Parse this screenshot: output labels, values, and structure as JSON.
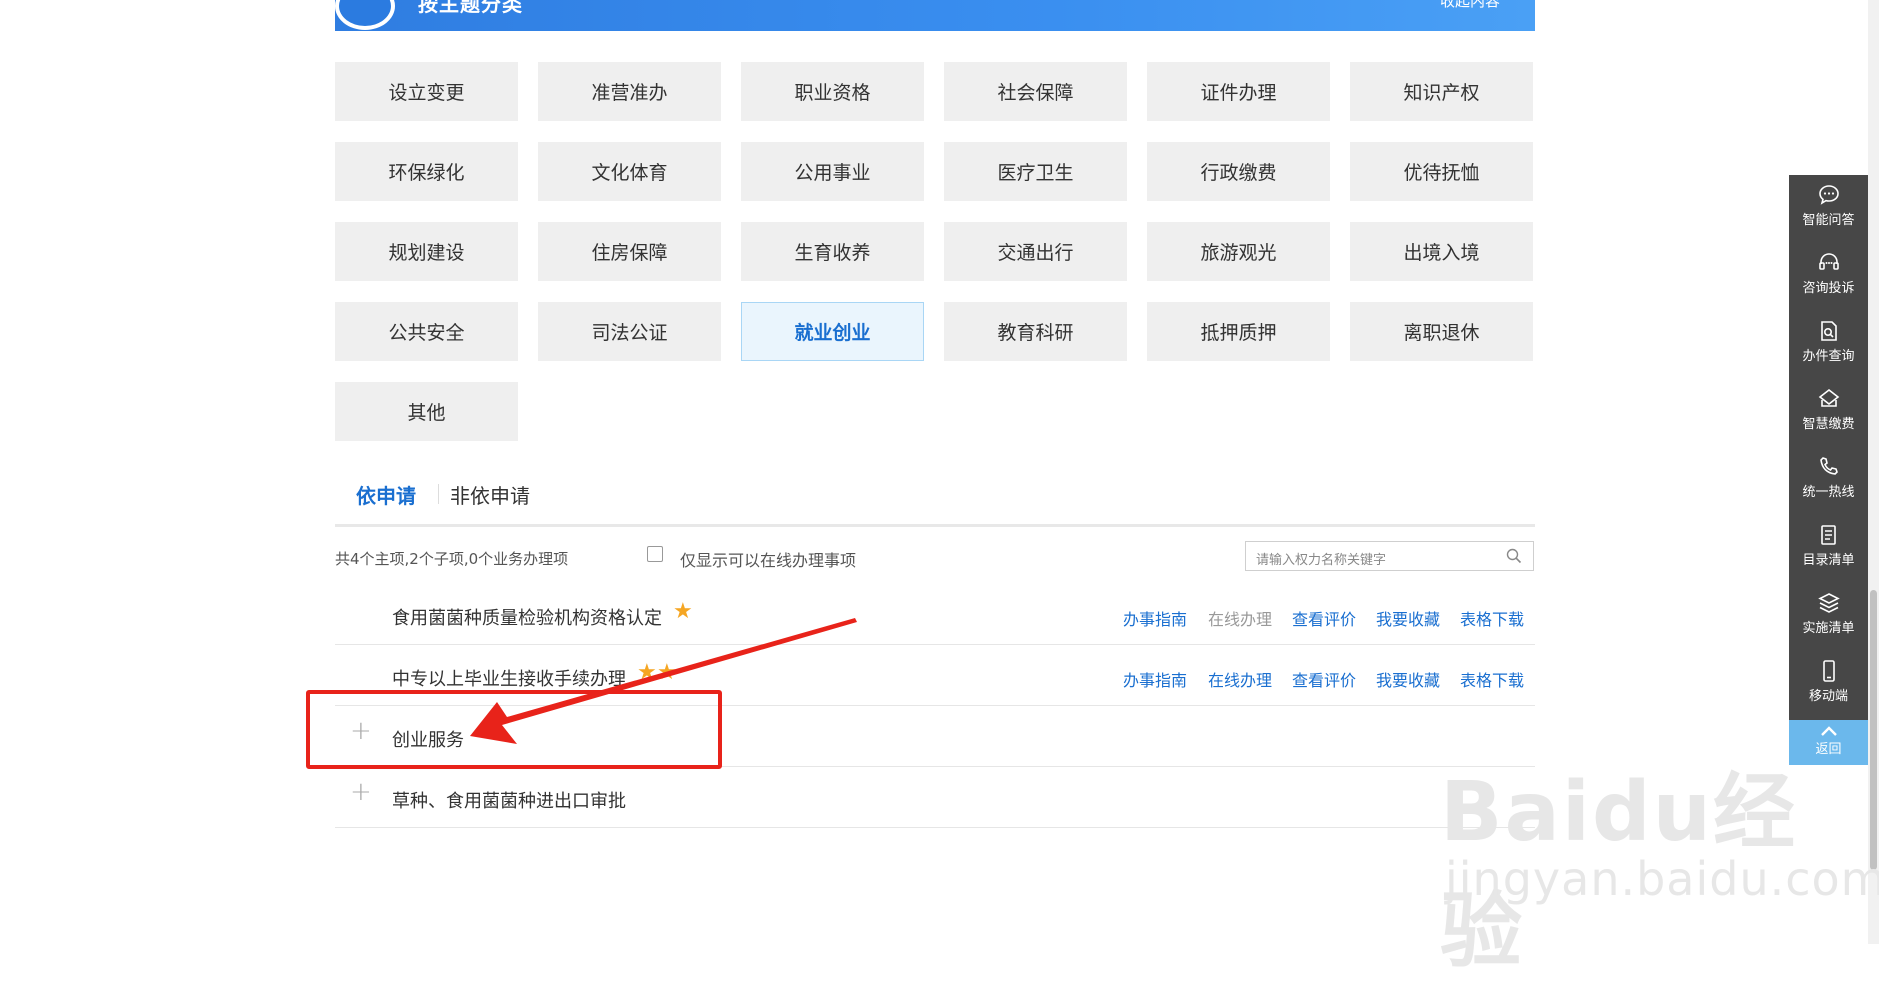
{
  "header": {
    "title": "按主题分类",
    "right_link": "收起内容"
  },
  "categories": [
    "设立变更",
    "准营准办",
    "职业资格",
    "社会保障",
    "证件办理",
    "知识产权",
    "环保绿化",
    "文化体育",
    "公用事业",
    "医疗卫生",
    "行政缴费",
    "优待抚恤",
    "规划建设",
    "住房保障",
    "生育收养",
    "交通出行",
    "旅游观光",
    "出境入境",
    "公共安全",
    "司法公证",
    "就业创业",
    "教育科研",
    "抵押质押",
    "离职退休",
    "其他"
  ],
  "active_category": "就业创业",
  "tabs": {
    "on": "依申请",
    "off": "非依申请"
  },
  "summary": "共4个主项,2个子项,0个业务办理项",
  "filter_label": "仅显示可以在线办理事项",
  "search": {
    "placeholder": "请输入权力名称关键字"
  },
  "items": [
    {
      "title": "食用菌菌种质量检验机构资格认定",
      "stars": 1,
      "actions": [
        "办事指南",
        "在线办理",
        "查看评价",
        "我要收藏",
        "表格下载"
      ],
      "online_enabled": false
    },
    {
      "title": "中专以上毕业生接收手续办理",
      "stars": 2,
      "actions": [
        "办事指南",
        "在线办理",
        "查看评价",
        "我要收藏",
        "表格下载"
      ],
      "online_enabled": true
    },
    {
      "title": "创业服务",
      "expandable": true
    },
    {
      "title": "草种、食用菌菌种进出口审批",
      "expandable": true
    }
  ],
  "sidebar": [
    {
      "label": "智能问答",
      "icon": "chat-bubble-icon"
    },
    {
      "label": "咨询投诉",
      "icon": "headset-icon"
    },
    {
      "label": "办件查询",
      "icon": "document-search-icon"
    },
    {
      "label": "智慧缴费",
      "icon": "payment-icon"
    },
    {
      "label": "统一热线",
      "icon": "phone-icon"
    },
    {
      "label": "目录清单",
      "icon": "list-icon"
    },
    {
      "label": "实施清单",
      "icon": "layers-icon"
    },
    {
      "label": "移动端",
      "icon": "mobile-icon"
    }
  ],
  "back_to_top": "返回",
  "watermark": {
    "line1": "Baidu经验",
    "line2": "jingyan.baidu.com"
  },
  "colors": {
    "accent": "#1a6fd0",
    "annotation": "#e8231a",
    "sidebar": "#474747"
  }
}
